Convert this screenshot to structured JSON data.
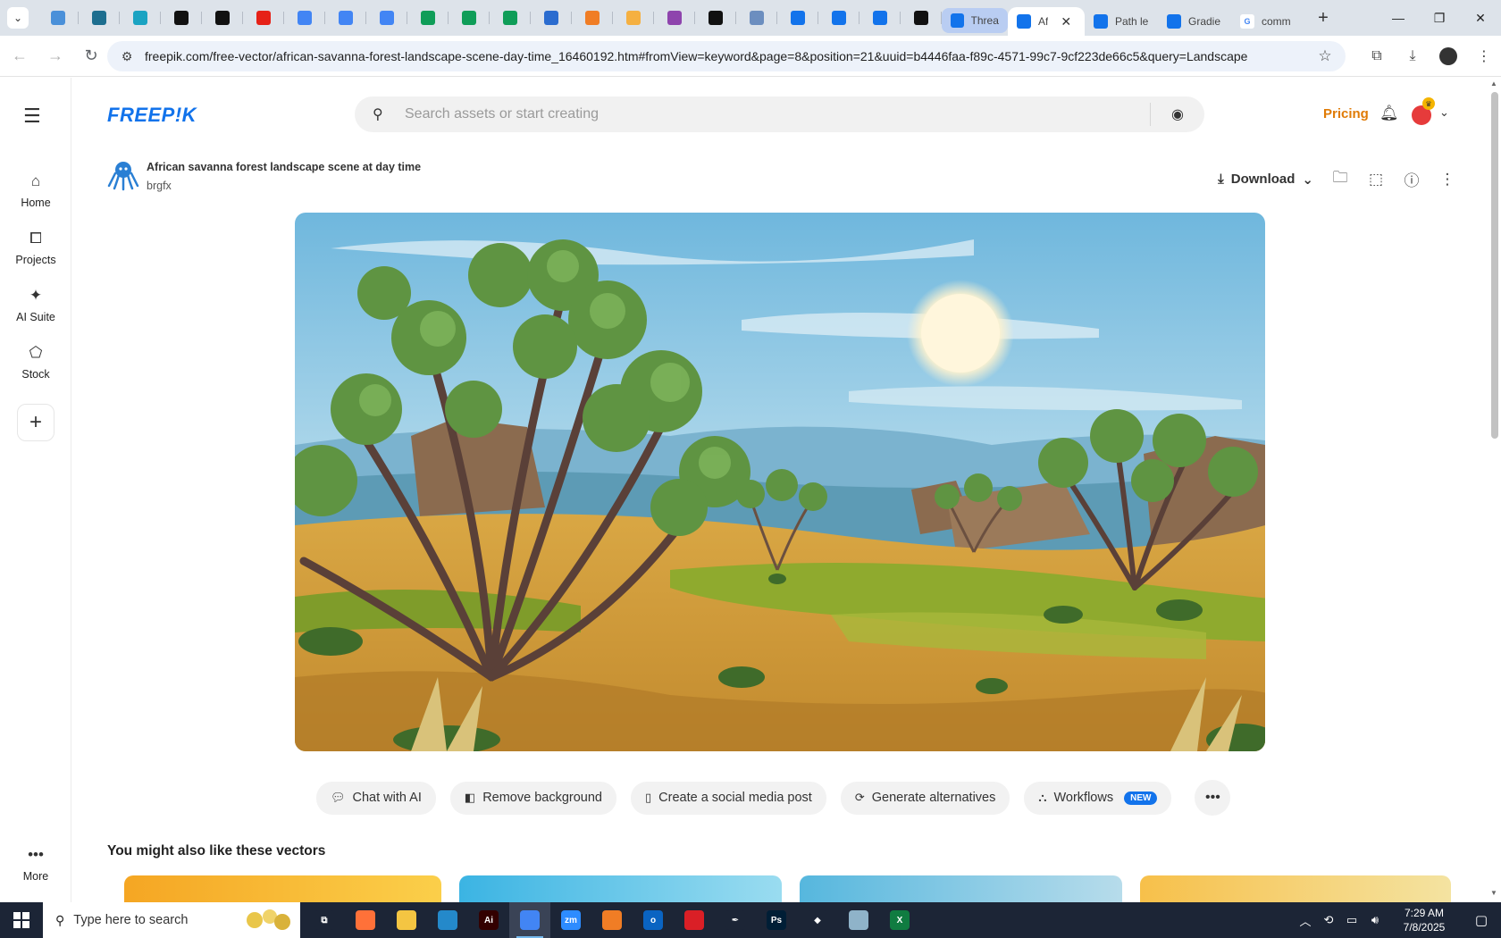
{
  "browser": {
    "pinned_tabs": [
      {
        "icon": "globe-blue-icon",
        "color": "#4a90d9"
      },
      {
        "icon": "shield-icon",
        "color": "#1d6e8f"
      },
      {
        "icon": "arrow-badge-icon",
        "color": "#1aa3c2"
      },
      {
        "icon": "openai-icon",
        "color": "#111111"
      },
      {
        "icon": "bolt-icon",
        "color": "#111111"
      },
      {
        "icon": "youtube-icon",
        "color": "#e62117"
      },
      {
        "icon": "docs-icon",
        "color": "#4285f4"
      },
      {
        "icon": "docs-icon",
        "color": "#4285f4"
      },
      {
        "icon": "docs-icon",
        "color": "#4285f4"
      },
      {
        "icon": "sheets-icon",
        "color": "#0f9d58"
      },
      {
        "icon": "sheets-icon",
        "color": "#0f9d58"
      },
      {
        "icon": "sheets-icon",
        "color": "#0f9d58"
      },
      {
        "icon": "word-icon",
        "color": "#2b6ccf"
      },
      {
        "icon": "xampp-icon",
        "color": "#f07d25"
      },
      {
        "icon": "ribbon-icon",
        "color": "#f5b041"
      },
      {
        "icon": "code-brackets-icon",
        "color": "#8e44ad"
      },
      {
        "icon": "a-letter-icon",
        "color": "#111111"
      },
      {
        "icon": "grid-icon",
        "color": "#6c8ebf"
      },
      {
        "icon": "forms-icon",
        "color": "#1273eb"
      },
      {
        "icon": "forms-icon",
        "color": "#1273eb"
      },
      {
        "icon": "forms-icon",
        "color": "#1273eb"
      },
      {
        "icon": "m-letter-icon",
        "color": "#111111"
      }
    ],
    "tabs": [
      {
        "label": "Threat",
        "state": "highlighted"
      },
      {
        "label": "Af",
        "state": "active",
        "close": "✕"
      },
      {
        "label": "Path le",
        "state": "normal"
      },
      {
        "label": "Gradie",
        "state": "normal"
      },
      {
        "label": "comm",
        "state": "normal",
        "icon": "google-icon"
      }
    ],
    "new_tab": "+",
    "url": "freepik.com/free-vector/african-savanna-forest-landscape-scene-day-time_16460192.htm#fromView=keyword&page=8&position=21&uuid=b4446faa-f89c-4571-99c7-9cf223de66c5&query=Landscape"
  },
  "site": {
    "logo": "FREEP!K",
    "search_placeholder": "Search assets or start creating",
    "pricing": "Pricing",
    "accent": "#1273eb",
    "pricing_color": "#e07b06"
  },
  "rail": {
    "items": [
      {
        "label": "Home",
        "icon": "home-icon"
      },
      {
        "label": "Projects",
        "icon": "projects-icon"
      },
      {
        "label": "AI Suite",
        "icon": "sparkle-icon"
      },
      {
        "label": "Stock",
        "icon": "stock-icon"
      }
    ],
    "more": "More"
  },
  "asset": {
    "title": "African savanna forest landscape scene at day time",
    "author": "brgfx",
    "download": "Download"
  },
  "tools": [
    {
      "label": "Chat with AI",
      "icon": "chat-icon"
    },
    {
      "label": "Remove background",
      "icon": "remove-bg-icon"
    },
    {
      "label": "Create a social media post",
      "icon": "phone-icon"
    },
    {
      "label": "Generate alternatives",
      "icon": "refresh-icon"
    },
    {
      "label": "Workflows",
      "icon": "workflow-icon",
      "badge": "NEW"
    }
  ],
  "related": {
    "heading": "You might also like these vectors"
  },
  "taskbar": {
    "search_placeholder": "Type here to search",
    "time": "7:29 AM",
    "date": "7/8/2025",
    "apps": [
      {
        "icon": "task-view-icon",
        "color": "#1c2536",
        "glyph": "⧉"
      },
      {
        "icon": "firefox-icon",
        "color": "#ff7139",
        "glyph": ""
      },
      {
        "icon": "file-explorer-icon",
        "color": "#f4c542",
        "glyph": ""
      },
      {
        "icon": "vscode-icon",
        "color": "#2489ca",
        "glyph": ""
      },
      {
        "icon": "illustrator-icon",
        "color": "#330000",
        "glyph": "Ai"
      },
      {
        "icon": "chrome-icon",
        "color": "#4285f4",
        "glyph": "",
        "active": true
      },
      {
        "icon": "zoom-icon",
        "color": "#2d8cff",
        "glyph": "zm"
      },
      {
        "icon": "xampp-icon",
        "color": "#f07d25",
        "glyph": ""
      },
      {
        "icon": "outlook-icon",
        "color": "#0a64c2",
        "glyph": "o"
      },
      {
        "icon": "creative-cloud-icon",
        "color": "#da1f26",
        "glyph": ""
      },
      {
        "icon": "pen-tool-icon",
        "color": "#1c2536",
        "glyph": "✒"
      },
      {
        "icon": "photoshop-icon",
        "color": "#001e36",
        "glyph": "Ps"
      },
      {
        "icon": "gem-icon",
        "color": "#1c2536",
        "glyph": "◆"
      },
      {
        "icon": "notepad-icon",
        "color": "#8fb3c9",
        "glyph": ""
      },
      {
        "icon": "excel-icon",
        "color": "#107c41",
        "glyph": "X"
      }
    ]
  }
}
